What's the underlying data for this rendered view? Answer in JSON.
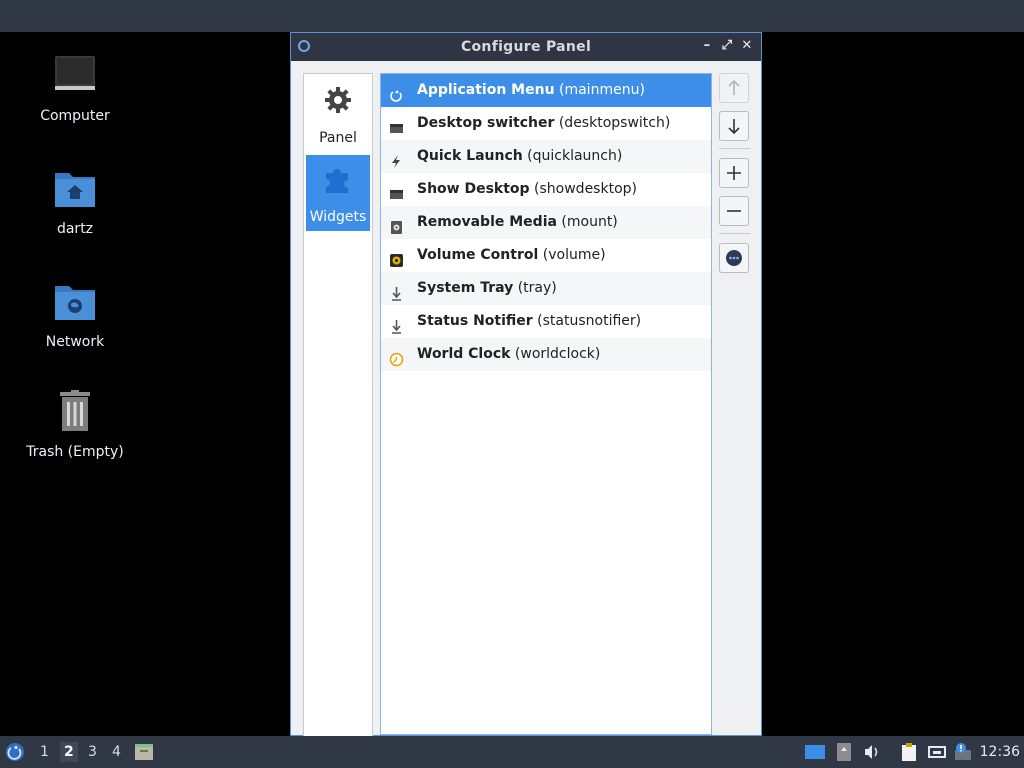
{
  "desktop": {
    "icons": [
      {
        "label": "Computer",
        "icon": "monitor-icon"
      },
      {
        "label": "dartz",
        "icon": "home-folder-icon"
      },
      {
        "label": "Network",
        "icon": "network-folder-icon"
      },
      {
        "label": "Trash (Empty)",
        "icon": "trash-icon"
      }
    ]
  },
  "window": {
    "title": "Configure Panel",
    "controls": {
      "minimize": "–",
      "maximize": "⤢",
      "close": "✕"
    }
  },
  "pages": [
    {
      "label": "Panel",
      "icon": "gear-icon",
      "selected": false
    },
    {
      "label": "Widgets",
      "icon": "puzzle-icon",
      "selected": true
    }
  ],
  "widgets": [
    {
      "name": "Application Menu",
      "id": "(mainmenu)",
      "icon": "app-menu-icon",
      "selected": true
    },
    {
      "name": "Desktop switcher",
      "id": "(desktopswitch)",
      "icon": "desktop-switcher-icon"
    },
    {
      "name": "Quick Launch",
      "id": "(quicklaunch)",
      "icon": "lightning-icon"
    },
    {
      "name": "Show Desktop",
      "id": "(showdesktop)",
      "icon": "show-desktop-icon"
    },
    {
      "name": "Removable Media",
      "id": "(mount)",
      "icon": "removable-media-icon"
    },
    {
      "name": "Volume Control",
      "id": "(volume)",
      "icon": "volume-icon"
    },
    {
      "name": "System Tray",
      "id": "(tray)",
      "icon": "tray-icon"
    },
    {
      "name": "Status Notifier",
      "id": "(statusnotifier)",
      "icon": "status-notifier-icon"
    },
    {
      "name": "World Clock",
      "id": "(worldclock)",
      "icon": "world-clock-icon"
    }
  ],
  "buttons": {
    "move_up": "arrow-up-icon",
    "move_down": "arrow-down-icon",
    "add": "plus-icon",
    "remove": "minus-icon",
    "configure": "more-options-icon"
  },
  "taskbar": {
    "desktops": [
      "1",
      "2",
      "3",
      "4"
    ],
    "active_desktop": "2",
    "clock": "12:36"
  },
  "colors": {
    "accent": "#3d8ee8",
    "panel": "#313845",
    "folder": "#4a90d9"
  }
}
